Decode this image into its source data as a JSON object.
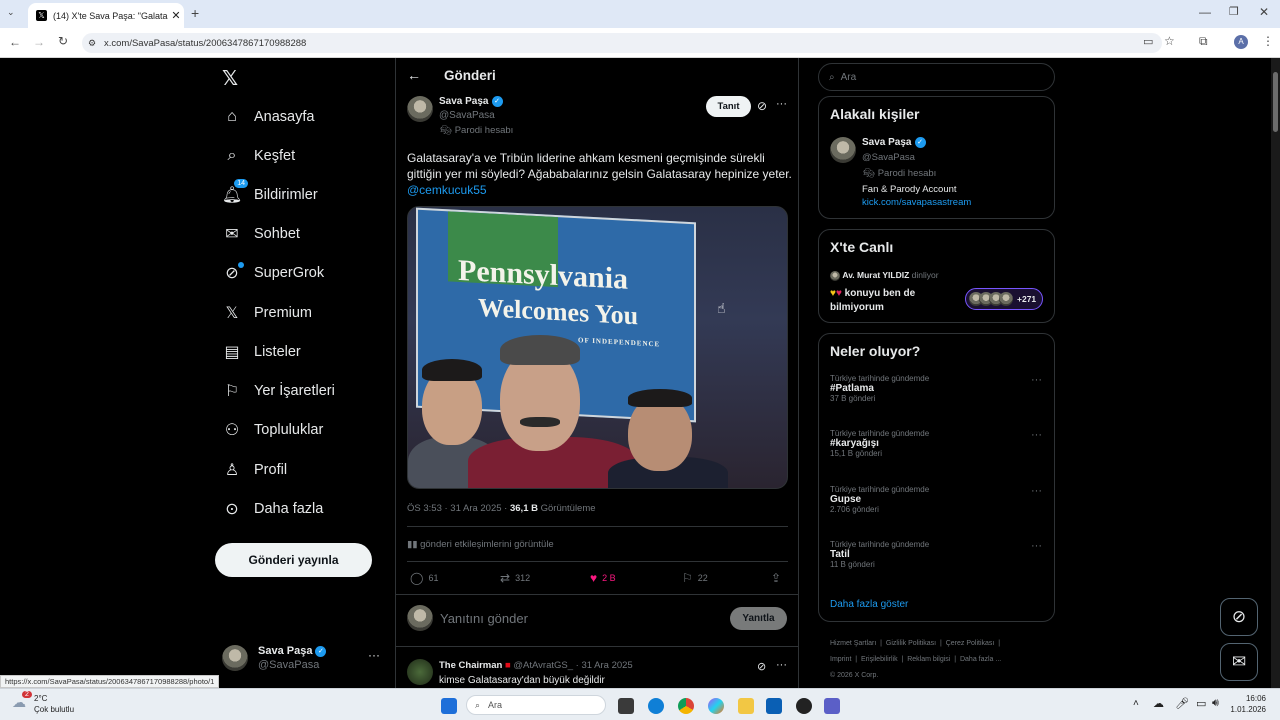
{
  "browser": {
    "tab_title": "(14) X'te Sava Paşa: \"Galatasaray'",
    "url": "x.com/SavaPasa/status/2006347867170988288",
    "status_url": "https://x.com/SavaPasa/status/2006347867170988288/photo/1",
    "profile_initial": "A"
  },
  "nav": {
    "items": [
      {
        "label": "Anasayfa",
        "icon": "home-icon"
      },
      {
        "label": "Keşfet",
        "icon": "search-icon"
      },
      {
        "label": "Bildirimler",
        "icon": "bell-icon",
        "badge": "14"
      },
      {
        "label": "Sohbet",
        "icon": "mail-icon"
      },
      {
        "label": "SuperGrok",
        "icon": "grok-icon"
      },
      {
        "label": "Premium",
        "icon": "x-logo-icon"
      },
      {
        "label": "Listeler",
        "icon": "list-icon"
      },
      {
        "label": "Yer İşaretleri",
        "icon": "bookmark-icon"
      },
      {
        "label": "Topluluklar",
        "icon": "communities-icon"
      },
      {
        "label": "Profil",
        "icon": "profile-icon"
      },
      {
        "label": "Daha fazla",
        "icon": "more-circle-icon"
      }
    ],
    "post_button": "Gönderi yayınla",
    "account_name": "Sava Paşa",
    "account_handle": "@SavaPasa"
  },
  "post": {
    "header": "Gönderi",
    "author_name": "Sava Paşa",
    "author_handle": "@SavaPasa",
    "parody_label": "Parodi hesabı",
    "follow_button": "Tanıt",
    "text": "Galatasaray'a ve Tribün liderine ahkam kesmeni geçmişinde sürekli gittiğin yer mi söyledi? Ağababalarınız gelsin Galatasaray hepinize yeter.",
    "mention": "@cemkucuk55",
    "photo_sign_line1": "Pennsylvania",
    "photo_sign_line2": "Welcomes You",
    "photo_sign_small": "OF INDEPENDENCE",
    "timestamp": "ÖS 3:53 · 31 Ara 2025 · ",
    "views_count": "36,1 B",
    "views_label": " Görüntüleme",
    "engagements": "gönderi etkileşimlerini görüntüle",
    "replies": "61",
    "reposts": "312",
    "likes": "2 B",
    "bookmarks": "22",
    "reply_placeholder": "Yanıtını gönder",
    "reply_button": "Yanıtla"
  },
  "reply_post": {
    "author_name": "The Chairman",
    "author_handle": "@AtAvratGS_",
    "date": "· 31 Ara 2025",
    "text": "kimse Galatasaray'dan büyük değildir"
  },
  "sidebar": {
    "search_placeholder": "Ara",
    "related_title": "Alakalı kişiler",
    "related_name": "Sava Paşa",
    "related_handle": "@SavaPasa",
    "related_parody": "Parodi hesabı",
    "related_bio": "Fan & Parody Account",
    "related_link": "kick.com/savapasastream",
    "live_title": "X'te Canlı",
    "live_host": "Av. Murat YILDIZ",
    "live_status": "dinliyor",
    "live_topic": "konuyu ben de bilmiyorum",
    "live_count": "+271",
    "trends_title": "Neler oluyor?",
    "trends": [
      {
        "context": "Türkiye tarihinde gündemde",
        "name": "#Patlama",
        "count": "37 B gönderi"
      },
      {
        "context": "Türkiye tarihinde gündemde",
        "name": "#karyağışı",
        "count": "15,1 B gönderi"
      },
      {
        "context": "Türkiye tarihinde gündemde",
        "name": "Gupse",
        "count": "2.706 gönderi"
      },
      {
        "context": "Türkiye tarihinde gündemde",
        "name": "Tatil",
        "count": "11 B gönderi"
      }
    ],
    "show_more": "Daha fazla göster",
    "footer": [
      "Hizmet Şartları",
      "Gizlilik Politikası",
      "Çerez Politikası",
      "Imprint",
      "Erişilebilirlik",
      "Reklam bilgisi",
      "Daha fazla ...",
      "© 2026 X Corp."
    ]
  },
  "taskbar": {
    "weather_temp": "2°C",
    "weather_desc": "Çok bulutlu",
    "weather_badge": "2",
    "search_placeholder": "Ara",
    "time": "16:06",
    "date": "1.01.2026"
  },
  "colors": {
    "accent": "#1d9bf0",
    "like": "#f91880",
    "bg": "#000000"
  }
}
